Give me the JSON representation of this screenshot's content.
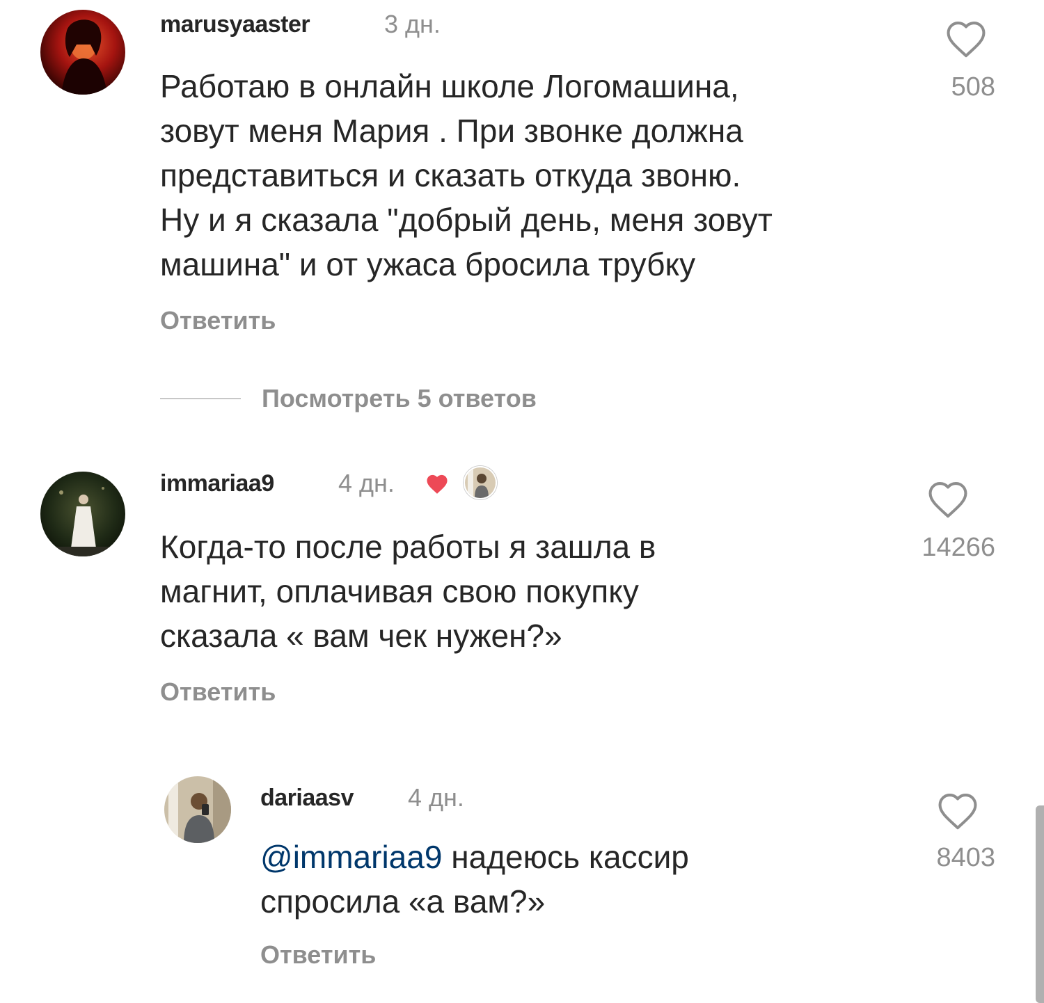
{
  "comments": [
    {
      "username": "marusyaaster",
      "time": "3 дн.",
      "text_lines": [
        "Работаю в онлайн школе Логомашина,",
        "зовут меня Мария . При звонке должна",
        "представиться и сказать откуда звоню.",
        "Ну и я сказала \"добрый день, меня зовут",
        "машина\" и от ужаса бросила трубку"
      ],
      "like_count": "508",
      "reply_label": "Ответить",
      "avatar_icon": "avatar-red-portrait"
    },
    {
      "username": "immariaa9",
      "time": "4 дн.",
      "text_lines": [
        "Когда-то после работы я зашла в",
        "магнит, оплачивая свою покупку",
        "сказала « вам чек нужен?»"
      ],
      "like_count": "14266",
      "reply_label": "Ответить",
      "avatar_icon": "avatar-night-portrait",
      "author_liked_icon": "red-heart-icon"
    },
    {
      "username": "dariaasv",
      "time": "4 дн.",
      "mention": "@immariaa9",
      "text_line1_rest": " надеюсь кассир",
      "text_line2": "спросила «а вам?»",
      "like_count": "8403",
      "reply_label": "Ответить",
      "avatar_icon": "avatar-indoor-portrait"
    }
  ],
  "view_replies_label": "Посмотреть 5 ответов",
  "colors": {
    "text": "#262626",
    "secondary": "#8e8e8e",
    "mention": "#00376b",
    "heart_red": "#ed4956"
  }
}
